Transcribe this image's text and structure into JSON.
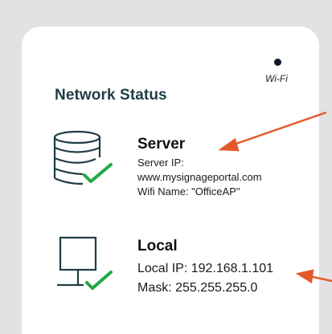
{
  "status_indicator": {
    "label": "Wi-Fi"
  },
  "network_status": {
    "title": "Network Status",
    "server": {
      "title": "Server",
      "ip_label": "Server IP:",
      "ip_value": "www.mysignageportal.com",
      "wifi_name": "Wifi Name: \"OfficeAP\""
    },
    "local": {
      "title": "Local",
      "ip": "Local IP: 192.168.1.101",
      "mask": "Mask: 255.255.255.0"
    }
  },
  "icons": {
    "server": "database-check-icon",
    "local": "monitor-check-icon"
  },
  "colors": {
    "background": "#e2e2e2",
    "card": "#ffffff",
    "heading": "#1f3d44",
    "check": "#22a846",
    "annotation_arrow": "#e25a2c"
  }
}
